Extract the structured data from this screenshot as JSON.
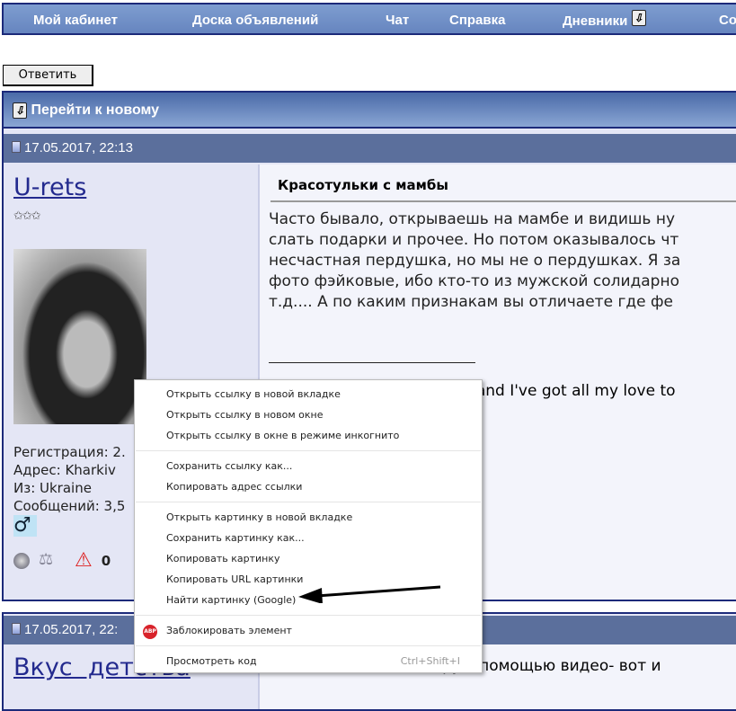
{
  "nav": {
    "items": [
      "Мой кабинет",
      "Доска объявлений",
      "Чат",
      "Справка",
      "Дневники",
      "Со"
    ]
  },
  "reply_button": "Ответить",
  "go_new": "Перейти к новому",
  "post1": {
    "date": "17.05.2017, 22:13",
    "username": "U-rets",
    "stars": "✩✩✩",
    "title": "Красотульки с мамбы",
    "body": [
      "Часто бывало, открываешь на мамбе и видишь ну",
      "слать подарки и прочее. Но потом оказывалось чт",
      "несчастная пердушка, но мы не о пердушках. Я за",
      "фото фэйковые, ибо кто-то из мужской солидарно",
      "т.д.... А по каким признакам вы отличаете где фе"
    ],
    "signature": "e and I've got all my love to",
    "info": [
      "Регистрация: 2.",
      "Адрес: Kharkiv",
      "Из: Ukraine",
      "Сообщений: 3,5"
    ],
    "gender_icon": "♂"
  },
  "post2": {
    "date": "17.05.2017, 22:",
    "username": "Вкус  детства",
    "body_partial": "пообщаться по вайберу с помощью видео- вот и"
  },
  "context_menu": {
    "groups": [
      [
        "Открыть ссылку в новой вкладке",
        "Открыть ссылку в новом окне",
        "Открыть ссылку в окне в режиме инкогнито"
      ],
      [
        "Сохранить ссылку как...",
        "Копировать адрес ссылки"
      ],
      [
        "Открыть картинку в новой вкладке",
        "Сохранить картинку как...",
        "Копировать картинку",
        "Копировать URL картинки",
        "Найти картинку (Google)"
      ]
    ],
    "block": "Заблокировать элемент",
    "abp": "ABP",
    "inspect": "Просмотреть код",
    "inspect_shortcut": "Ctrl+Shift+I"
  }
}
